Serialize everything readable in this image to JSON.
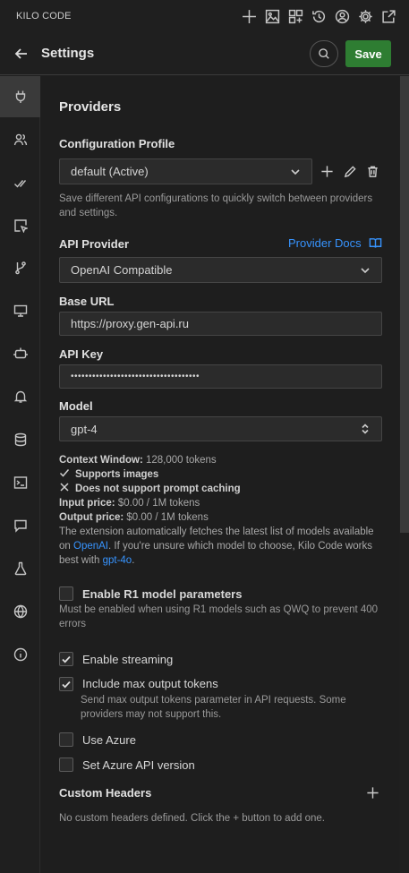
{
  "app": {
    "title": "KILO CODE"
  },
  "topbar_icons": [
    "plus-icon",
    "image-icon",
    "grid-icon",
    "history-icon",
    "account-icon",
    "gear-icon",
    "popout-icon"
  ],
  "header": {
    "title": "Settings",
    "save_label": "Save"
  },
  "sidebar": {
    "items": [
      "plug-icon",
      "users-icon",
      "check-icon",
      "pointer-icon",
      "branch-icon",
      "monitor-icon",
      "robot-icon",
      "bell-icon",
      "database-icon",
      "terminal-icon",
      "chat-icon",
      "flask-icon",
      "globe-icon",
      "info-icon"
    ],
    "active_index": 0
  },
  "providers": {
    "heading": "Providers",
    "config_profile": {
      "label": "Configuration Profile",
      "value": "default (Active)",
      "help": "Save different API configurations to quickly switch between providers and settings."
    },
    "api_provider": {
      "label": "API Provider",
      "docs_link": "Provider Docs",
      "value": "OpenAI Compatible"
    },
    "base_url": {
      "label": "Base URL",
      "value": "https://proxy.gen-api.ru"
    },
    "api_key": {
      "label": "API Key",
      "value": "••••••••••••••••••••••••••••••••••••"
    },
    "model": {
      "label": "Model",
      "value": "gpt-4"
    },
    "model_info": {
      "context_label": "Context Window:",
      "context_value": "128,000 tokens",
      "supports_images": "Supports images",
      "no_caching": "Does not support prompt caching",
      "input_label": "Input price:",
      "input_value": "$0.00 / 1M tokens",
      "output_label": "Output price:",
      "output_value": "$0.00 / 1M tokens",
      "desc_1": "The extension automatically fetches the latest list of models available",
      "desc_2_pre": "on ",
      "desc_2_link": "OpenAI",
      "desc_2_post": ". If you're unsure which model to choose, Kilo Code works",
      "desc_3_pre": "best with ",
      "desc_3_link": "gpt-4o",
      "desc_3_post": "."
    },
    "r1": {
      "label": "Enable R1 model parameters",
      "checked": false,
      "help": "Must be enabled when using R1 models such as QWQ to prevent 400 errors"
    },
    "streaming": {
      "label": "Enable streaming",
      "checked": true
    },
    "max_tokens": {
      "label": "Include max output tokens",
      "checked": true,
      "help": "Send max output tokens parameter in API requests. Some providers may not support this."
    },
    "azure": {
      "label": "Use Azure",
      "checked": false
    },
    "azure_version": {
      "label": "Set Azure API version",
      "checked": false
    },
    "custom_headers": {
      "label": "Custom Headers",
      "empty": "No custom headers defined. Click the + button to add one."
    }
  }
}
